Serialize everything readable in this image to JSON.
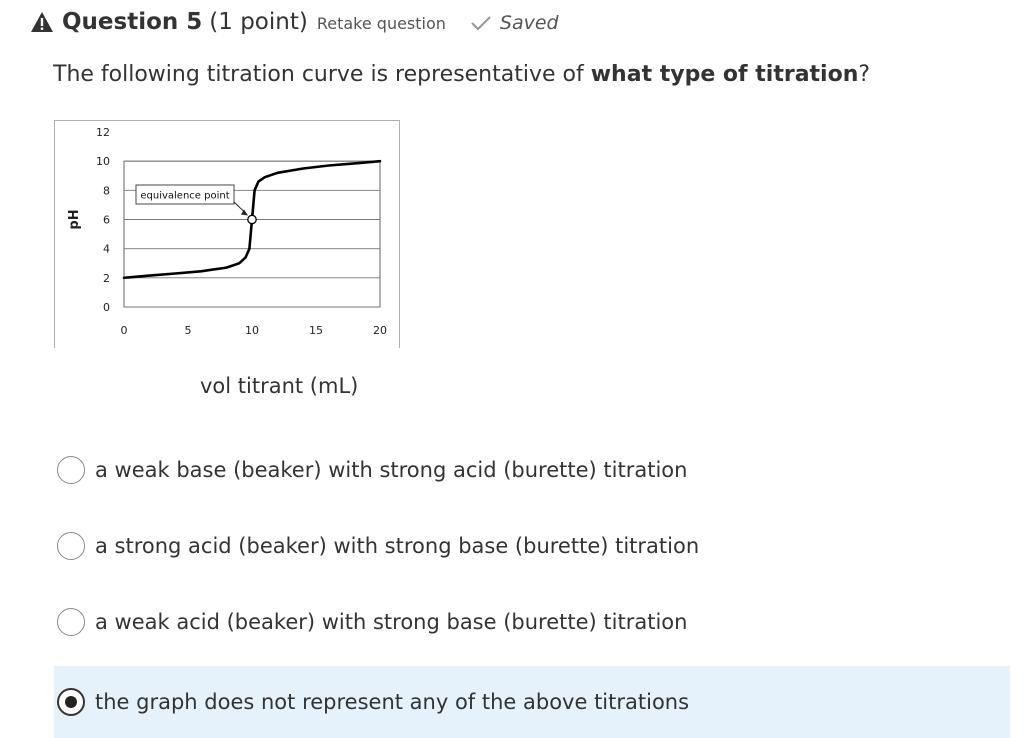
{
  "header": {
    "icon": "warning-triangle-icon",
    "title": "Question 5",
    "points": "(1 point)",
    "retake_label": "Retake question",
    "saved_icon": "checkmark-icon",
    "saved_label": "Saved"
  },
  "question": {
    "text_before": "The following titration curve is representative of ",
    "text_bold": "what type of titration",
    "text_after": "?"
  },
  "chart_data": {
    "type": "line",
    "ylabel": "pH",
    "xlabel": "vol titrant (mL)",
    "x_ticks": [
      "0",
      "5",
      "10",
      "15",
      "20"
    ],
    "y_ticks": [
      "0",
      "2",
      "4",
      "6",
      "8",
      "10",
      "12"
    ],
    "xlim": [
      0,
      20
    ],
    "ylim": [
      0,
      12
    ],
    "grid": "horizontal",
    "series": [
      {
        "x": [
          0,
          2,
          4,
          6,
          8,
          9,
          9.5,
          9.8,
          9.9,
          10,
          10.1,
          10.2,
          10.5,
          11,
          12,
          14,
          16,
          18,
          20
        ],
        "y": [
          2.0,
          2.15,
          2.3,
          2.45,
          2.7,
          3.0,
          3.4,
          4.0,
          5.0,
          6.0,
          7.0,
          8.0,
          8.6,
          8.9,
          9.2,
          9.5,
          9.7,
          9.85,
          10.0
        ]
      }
    ],
    "annotation": {
      "text": "equivalence point",
      "x": 10,
      "y": 6
    }
  },
  "options": [
    {
      "label": "a weak base (beaker) with strong acid (burette) titration",
      "selected": false
    },
    {
      "label": "a strong acid (beaker) with strong base (burette) titration",
      "selected": false
    },
    {
      "label": "a weak acid (beaker) with strong base (burette) titration",
      "selected": false
    },
    {
      "label": "the graph does not represent any of the above titrations",
      "selected": true
    }
  ],
  "colors": {
    "selected_background": "#e5f1fb",
    "text": "#333333"
  }
}
